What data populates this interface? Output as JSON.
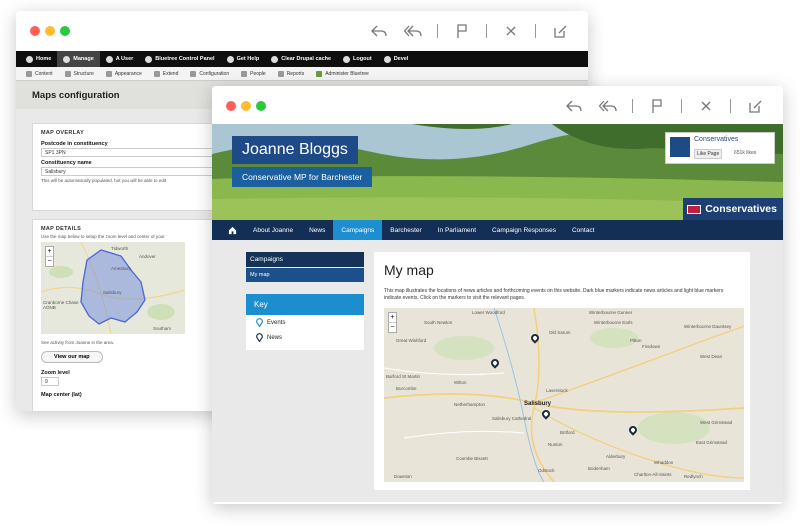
{
  "admin": {
    "toolbar": [
      "Home",
      "Manage",
      "A User",
      "Bluetree Control Panel",
      "Get Help",
      "Clear Drupal cache",
      "Logout",
      "Devel"
    ],
    "subbar": [
      "Content",
      "Structure",
      "Appearance",
      "Extend",
      "Configuration",
      "People",
      "Reports",
      "Administer Bluetree"
    ],
    "page_title": "Maps configuration",
    "overlay": {
      "heading": "MAP OVERLAY",
      "postcode_label": "Postcode in constituency",
      "postcode_value": "SP1 3PN",
      "constituency_label": "Constituency name",
      "constituency_value": "Salisbury",
      "description": "This will be automatically populated, but you will be able to edit"
    },
    "details": {
      "heading": "MAP DETAILS",
      "description": "Use the map below to setup the zoom level and center of your",
      "map_labels": [
        "Tidworth",
        "Andover",
        "Amesbury",
        "Salisbury",
        "Cranborne Chase AONB",
        "Southam"
      ],
      "map_zoom": [
        "+",
        "−"
      ],
      "activity_text": "See activity from Joanne in the area.",
      "view_button": "View our map",
      "zoom_label": "Zoom level",
      "zoom_value": "9",
      "map_center_label": "Map center (lat)"
    }
  },
  "site": {
    "mp_name": "Joanne Bloggs",
    "mp_title": "Conservative MP for Barchester",
    "facebook": {
      "page": "Conservatives",
      "like": "Like Page",
      "count": "651k likes"
    },
    "party": "Conservatives",
    "nav": [
      "About Joanne",
      "News",
      "Campaigns",
      "Barchester",
      "In Parliament",
      "Campaign Responses",
      "Contact"
    ],
    "nav_active": "Campaigns",
    "sidebar": {
      "heading": "Campaigns",
      "item": "My map"
    },
    "key": {
      "title": "Key",
      "events": "Events",
      "news": "News"
    },
    "page_heading": "My map",
    "intro": "This map illustrates the locations of news articles and forthcoming events on this website. Dark blue markers indicate news articles and light blue markers indicate events. Click on the markers to visit the relevant pages.",
    "map_zoom": [
      "+",
      "−"
    ],
    "map_labels": [
      "Lower Woodford",
      "Winterbourne Gunner",
      "South Newton",
      "Winterbourne Earls",
      "Winterbourne Dauntsey",
      "Old Sarum",
      "Great Wishford",
      "Pitton",
      "Firsdown",
      "West Dean",
      "Wilton",
      "Barford St Martin",
      "Burcombe",
      "Netherhampton",
      "Laverstock",
      "Salisbury",
      "Salisbury Cathedral",
      "Britford",
      "Alderbury",
      "Whaddon",
      "East Grimstead",
      "Coombe Bissett",
      "Odstock",
      "Nunton",
      "Bodenham",
      "Charlton-All-Saints",
      "Downton",
      "Redlynch",
      "West Grimstead"
    ]
  },
  "colors": {
    "toolbar": "#0f0f0f",
    "site_nav": "#132f55",
    "nav_active": "#1d8ecf",
    "name_box": "#1e4b87"
  }
}
